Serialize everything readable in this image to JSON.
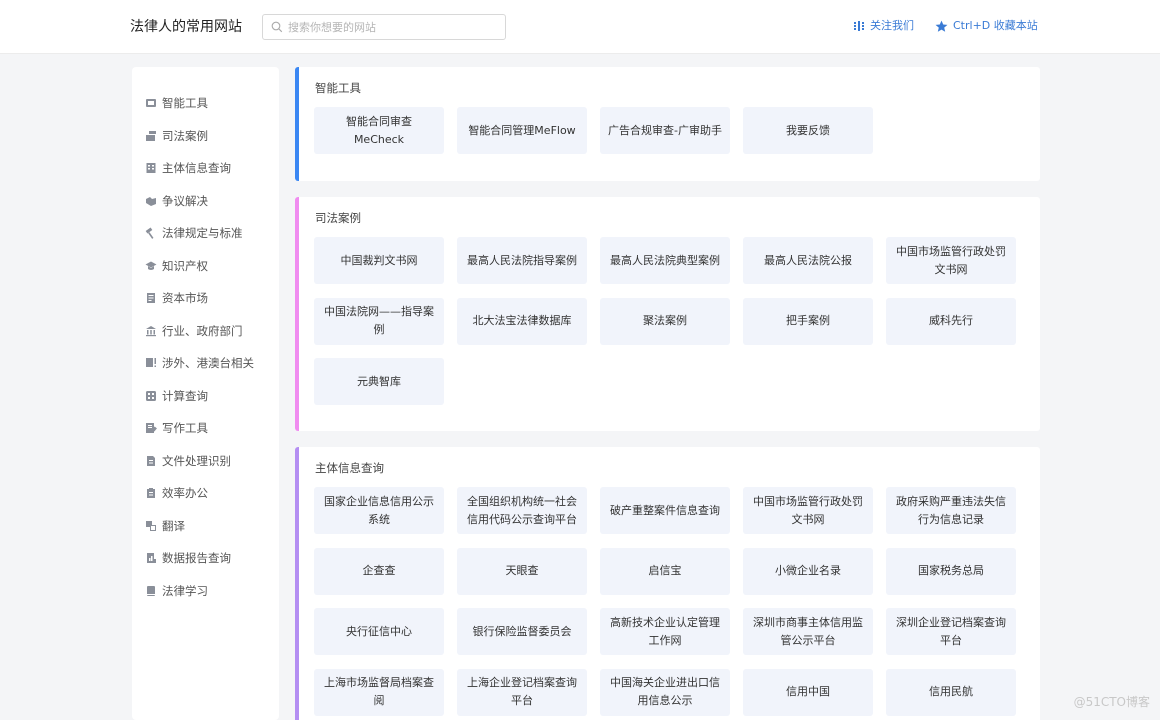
{
  "header": {
    "brand": "法律人的常用网站",
    "search_placeholder": "搜索你想要的网站",
    "follow_label": "关注我们",
    "favorite_label": "Ctrl+D 收藏本站"
  },
  "colors": {
    "accent": "#3a7bd5",
    "bar_tools": "#3a87f3",
    "bar_cases": "#f08cf0",
    "bar_entity": "#b48ef2"
  },
  "sidebar": {
    "items": [
      {
        "label": "智能工具",
        "icon": "tools-icon"
      },
      {
        "label": "司法案例",
        "icon": "gavel-book-icon"
      },
      {
        "label": "主体信息查询",
        "icon": "building-icon"
      },
      {
        "label": "争议解决",
        "icon": "handshake-icon"
      },
      {
        "label": "法律规定与标准",
        "icon": "hammer-icon"
      },
      {
        "label": "知识产权",
        "icon": "graduation-cap-icon"
      },
      {
        "label": "资本市场",
        "icon": "document-icon"
      },
      {
        "label": "行业、政府部门",
        "icon": "bank-icon"
      },
      {
        "label": "涉外、港澳台相关",
        "icon": "flag-icon"
      },
      {
        "label": "计算查询",
        "icon": "calculator-icon"
      },
      {
        "label": "写作工具",
        "icon": "edit-icon"
      },
      {
        "label": "文件处理识别",
        "icon": "file-icon"
      },
      {
        "label": "效率办公",
        "icon": "clipboard-icon"
      },
      {
        "label": "翻译",
        "icon": "translate-icon"
      },
      {
        "label": "数据报告查询",
        "icon": "report-icon"
      },
      {
        "label": "法律学习",
        "icon": "book-icon"
      }
    ]
  },
  "sections": [
    {
      "title": "智能工具",
      "items": [
        "智能合同审查MeCheck",
        "智能合同管理MeFlow",
        "广告合规审查-广审助手",
        "我要反馈"
      ]
    },
    {
      "title": "司法案例",
      "items": [
        "中国裁判文书网",
        "最高人民法院指导案例",
        "最高人民法院典型案例",
        "最高人民法院公报",
        "中国市场监管行政处罚文书网",
        "中国法院网——指导案例",
        "北大法宝法律数据库",
        "聚法案例",
        "把手案例",
        "威科先行",
        "元典智库"
      ]
    },
    {
      "title": "主体信息查询",
      "items": [
        "国家企业信息信用公示系统",
        "全国组织机构统一社会信用代码公示查询平台",
        "破产重整案件信息查询",
        "中国市场监管行政处罚文书网",
        "政府采购严重违法失信行为信息记录",
        "企查查",
        "天眼查",
        "启信宝",
        "小微企业名录",
        "国家税务总局",
        "央行征信中心",
        "银行保险监督委员会",
        "高新技术企业认定管理工作网",
        "深圳市商事主体信用监管公示平台",
        "深圳企业登记档案查询平台",
        "上海市场监督局档案查阅",
        "上海企业登记档案查询平台",
        "中国海关企业进出口信用信息公示",
        "信用中国",
        "信用民航"
      ]
    }
  ],
  "watermark": "@51CTO博客"
}
